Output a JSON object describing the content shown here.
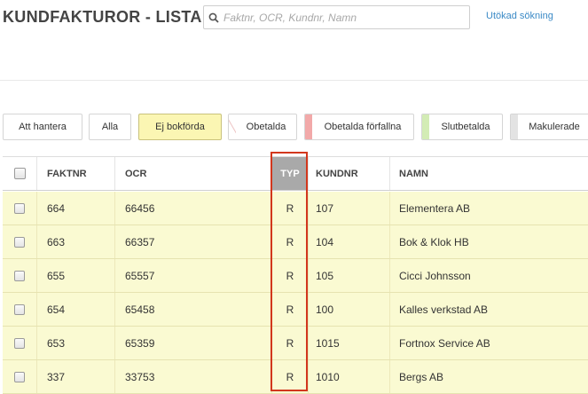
{
  "header": {
    "title": "KUNDFAKTUROR - LISTA",
    "search_placeholder": "Faktnr, OCR, Kundnr, Namn",
    "advanced_search_link": "Utökad sökning"
  },
  "filters": [
    {
      "label": "Att hantera",
      "active": false,
      "stripe": ""
    },
    {
      "label": "Alla",
      "active": false,
      "stripe": ""
    },
    {
      "label": "Ej bokförda",
      "active": true,
      "stripe": ""
    },
    {
      "label": "Obetalda",
      "active": false,
      "stripe": "#ebebeb"
    },
    {
      "label": "Obetalda förfallna",
      "active": false,
      "stripe": "#f2a9a9"
    },
    {
      "label": "Slutbetalda",
      "active": false,
      "stripe": "#d3ecb5"
    },
    {
      "label": "Makulerade",
      "active": false,
      "stripe": "#e3e3e3"
    }
  ],
  "table": {
    "columns": [
      "FAKTNR",
      "OCR",
      "TYP",
      "KUNDNR",
      "NAMN"
    ],
    "rows": [
      {
        "faktnr": "664",
        "ocr": "66456",
        "typ": "R",
        "kundnr": "107",
        "namn": "Elementera AB"
      },
      {
        "faktnr": "663",
        "ocr": "66357",
        "typ": "R",
        "kundnr": "104",
        "namn": "Bok & Klok HB"
      },
      {
        "faktnr": "655",
        "ocr": "65557",
        "typ": "R",
        "kundnr": "105",
        "namn": "Cicci Johnsson"
      },
      {
        "faktnr": "654",
        "ocr": "65458",
        "typ": "R",
        "kundnr": "100",
        "namn": "Kalles verkstad AB"
      },
      {
        "faktnr": "653",
        "ocr": "65359",
        "typ": "R",
        "kundnr": "1015",
        "namn": "Fortnox Service AB"
      },
      {
        "faktnr": "337",
        "ocr": "33753",
        "typ": "R",
        "kundnr": "1010",
        "namn": "Bergs AB"
      }
    ]
  },
  "colors": {
    "row_background": "#fafad2",
    "active_filter": "#fbf6b3",
    "highlight_border": "#d2371d",
    "link": "#3b8ac6"
  }
}
